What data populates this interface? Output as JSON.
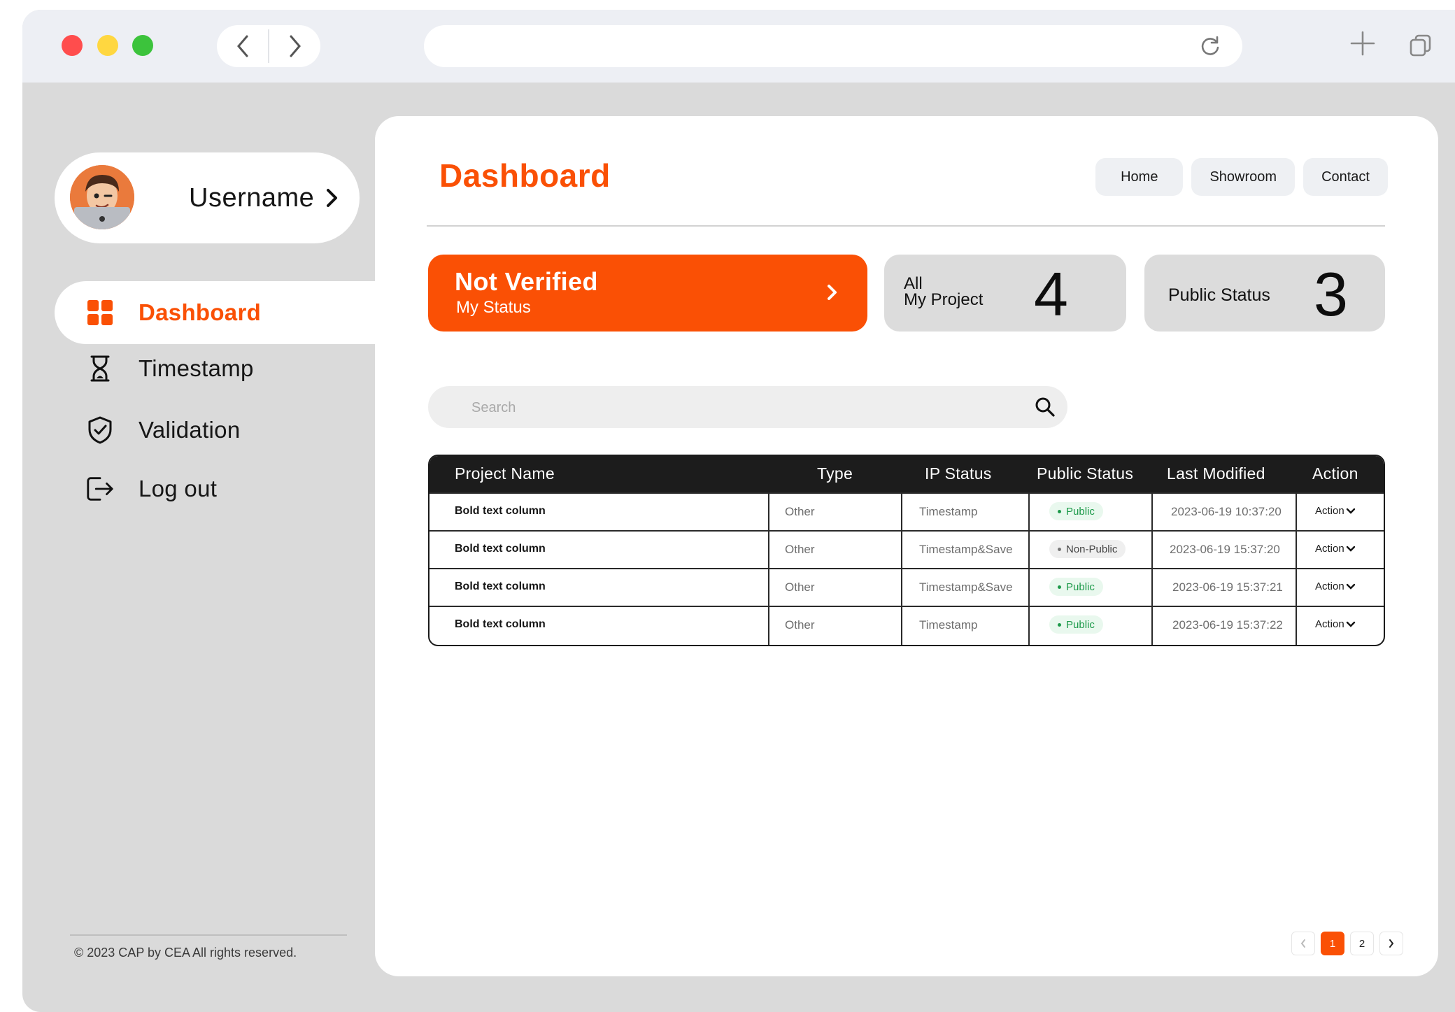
{
  "sidebar": {
    "username": "Username",
    "items": [
      {
        "label": "Dashboard",
        "icon": "dashboard-grid-icon",
        "active": true
      },
      {
        "label": "Timestamp",
        "icon": "hourglass-icon"
      },
      {
        "label": "Validation",
        "icon": "shield-check-icon"
      },
      {
        "label": "Log out",
        "icon": "logout-icon"
      }
    ],
    "footer": "© 2023  CAP by CEA All rights reserved."
  },
  "header": {
    "title": "Dashboard",
    "nav": [
      "Home",
      "Showroom",
      "Contact"
    ]
  },
  "status_card": {
    "title": "Not Verified",
    "subtitle": "My Status"
  },
  "stats": [
    {
      "line1": "All",
      "line2": "My Project",
      "value": "4"
    },
    {
      "label": "Public Status",
      "value": "3"
    }
  ],
  "search": {
    "placeholder": "Search"
  },
  "table": {
    "headers": [
      "Project Name",
      "Type",
      "IP Status",
      "Public Status",
      "Last Modified",
      "Action"
    ],
    "rows": [
      {
        "name": "Bold text column",
        "type": "Other",
        "ip_status": "Timestamp",
        "public_status": "Public",
        "modified": "2023-06-19 10:37:20",
        "action": "Action"
      },
      {
        "name": "Bold text column",
        "type": "Other",
        "ip_status": "Timestamp&Save",
        "public_status": "Non-Public",
        "modified": "2023-06-19 15:37:20",
        "action": "Action"
      },
      {
        "name": "Bold text column",
        "type": "Other",
        "ip_status": "Timestamp&Save",
        "public_status": "Public",
        "modified": "2023-06-19 15:37:21",
        "action": "Action"
      },
      {
        "name": "Bold text column",
        "type": "Other",
        "ip_status": "Timestamp",
        "public_status": "Public",
        "modified": "2023-06-19 15:37:22",
        "action": "Action"
      }
    ]
  },
  "pagination": {
    "pages": [
      "1",
      "2"
    ],
    "current": "1"
  },
  "colors": {
    "accent": "#fa5005",
    "public_green": "#1d9a4a",
    "window_bg": "#dadada"
  }
}
